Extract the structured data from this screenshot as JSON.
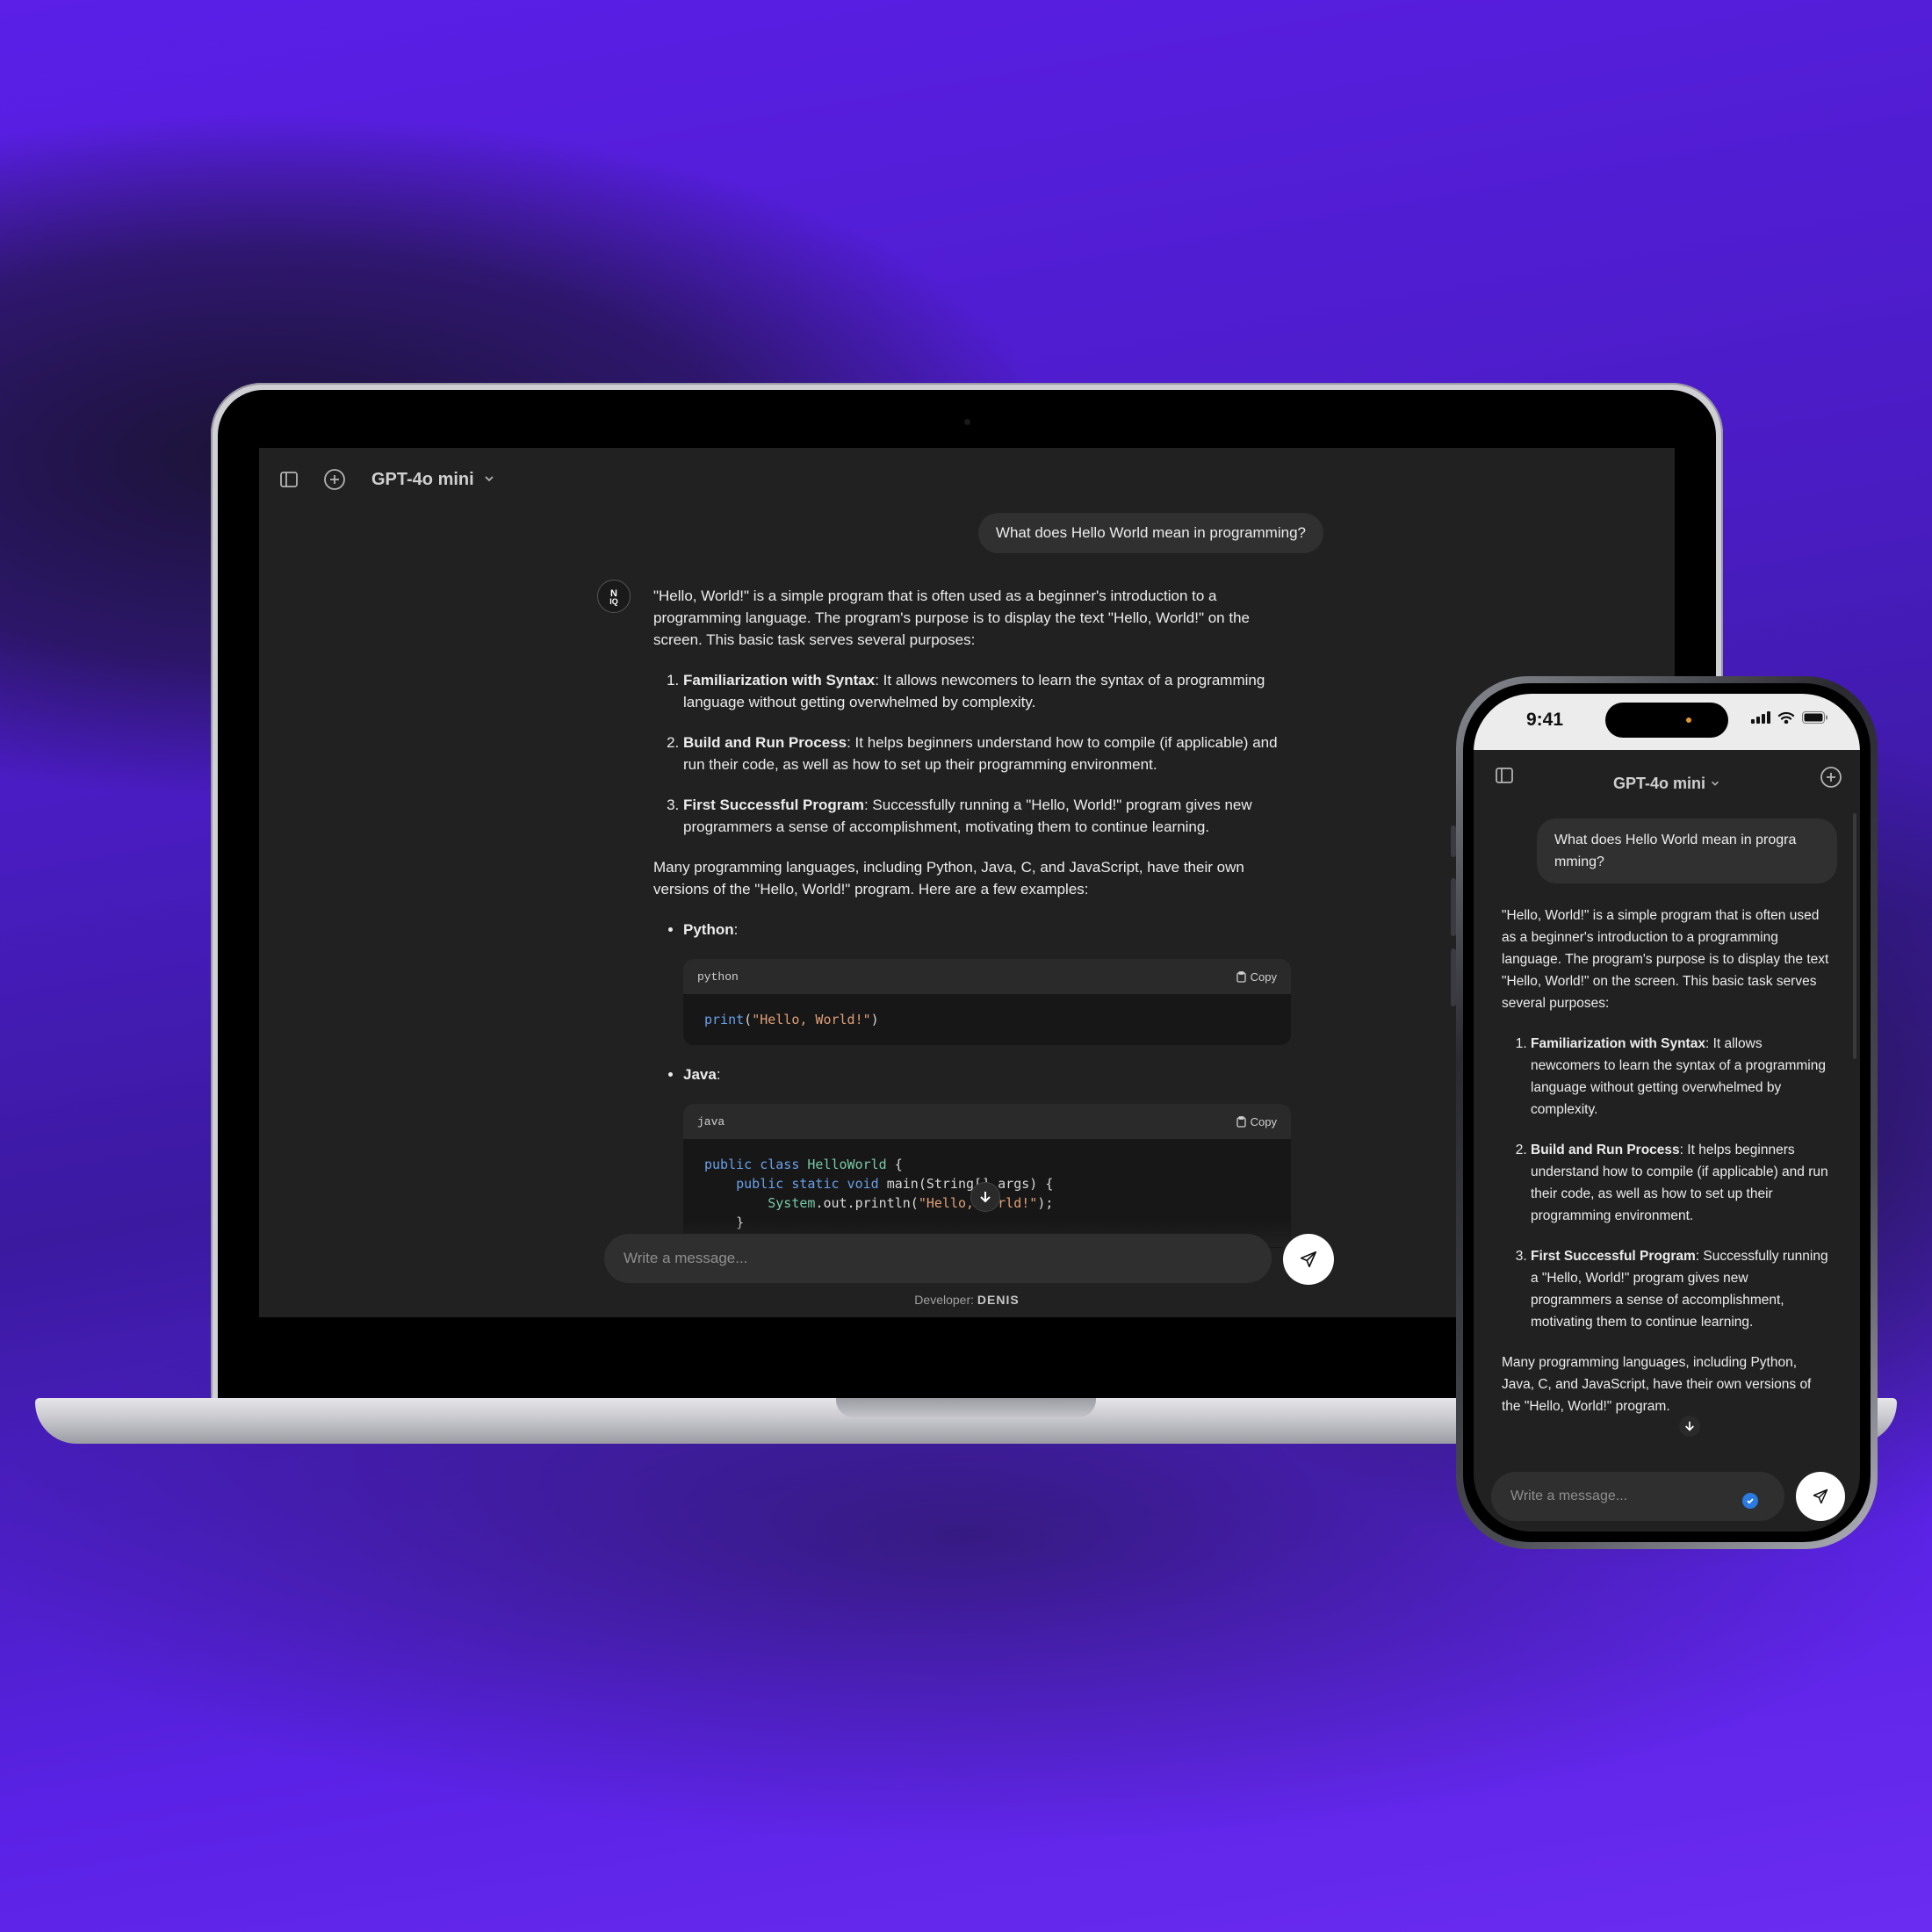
{
  "colors": {
    "background": "#5a22e6",
    "app_bg": "#212121",
    "bubble": "#303030",
    "code_bg": "#171717",
    "accent_blue": "#2a7ae2"
  },
  "laptop": {
    "model_label": "GPT-4o mini",
    "user_message": "What does Hello World mean in programming?",
    "answer": {
      "intro": "\"Hello, World!\" is a simple program that is often used as a beginner's introduction to a programming language. The program's purpose is to display the text \"Hello, World!\" on the screen. This basic task serves several purposes:",
      "points": [
        {
          "title": "Familiarization with Syntax",
          "text": ": It allows newcomers to learn the syntax of a programming language without getting overwhelmed by complexity."
        },
        {
          "title": "Build and Run Process",
          "text": ": It helps beginners understand how to compile (if applicable) and run their code, as well as how to set up their programming environment."
        },
        {
          "title": "First Successful Program",
          "text": ": Successfully running a \"Hello, World!\" program gives new programmers a sense of accomplishment, motivating them to continue learning."
        }
      ],
      "examples_intro": "Many programming languages, including Python, Java, C, and JavaScript, have their own versions of the \"Hello, World!\" program. Here are a few examples:",
      "examples": [
        {
          "name": "Python",
          "lang": "python",
          "copy_label": "Copy",
          "code": [
            "print(\"Hello, World!\")"
          ]
        },
        {
          "name": "Java",
          "lang": "java",
          "copy_label": "Copy",
          "code": [
            "public class HelloWorld {",
            "    public static void main(String[] args) {",
            "        System.out.println(\"Hello, World!\");",
            "    }"
          ]
        }
      ]
    },
    "composer_placeholder": "Write a message...",
    "developer_label": "Developer:",
    "developer_name": "DENIS"
  },
  "phone": {
    "time": "9:41",
    "model_label": "GPT-4o mini",
    "user_message": "What does Hello World mean in progra mming?",
    "answer": {
      "intro": "\"Hello, World!\" is a simple program that is often used as a beginner's introduction to a programming language. The program's purpose is to display the text \"Hello, World!\" on the screen. This basic task serves several purposes:",
      "points": [
        {
          "title": "Familiarization with Syntax",
          "text": ": It allows newcomers to learn the syntax of a programming language without getting overwhelmed by complexity."
        },
        {
          "title": "Build and Run Process",
          "text": ": It helps beginners understand how to compile (if applicable) and run their code, as well as how to set up their programming environment."
        },
        {
          "title": "First Successful Program",
          "text": ": Successfully running a \"Hello, World!\" program gives new programmers a sense of accomplishment, motivating them to continue learning."
        }
      ],
      "examples_intro": "Many programming languages, including Python, Java, C, and JavaScript, have their own versions of the \"Hello, World!\" program."
    },
    "composer_placeholder": "Write a message..."
  },
  "icons": {
    "sidebar": "sidebar-toggle-icon",
    "new_chat": "plus-circle-icon",
    "chevron": "chevron-down-icon",
    "send": "paper-plane-icon",
    "copy": "clipboard-icon",
    "scroll": "arrow-down-icon",
    "logo": "ni-logo"
  }
}
